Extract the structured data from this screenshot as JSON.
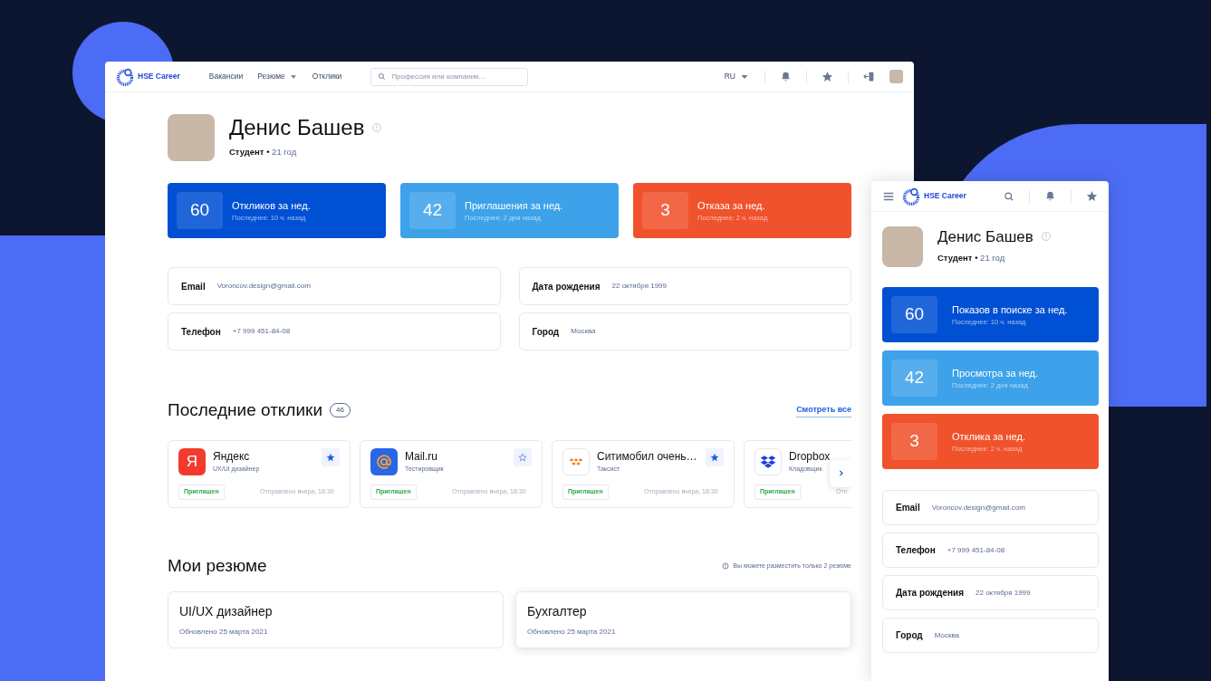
{
  "desktop": {
    "nav": {
      "logo": "HSE Career",
      "links": [
        {
          "label": "Вакансии",
          "dropdown": false
        },
        {
          "label": "Резюме",
          "dropdown": true
        },
        {
          "label": "Отклики",
          "dropdown": false
        }
      ],
      "search": {
        "placeholder": "Профессия или компания..."
      },
      "language": "RU"
    },
    "profile": {
      "name": "Денис Башев",
      "role": "Студент",
      "separator": "•",
      "age": "21 год"
    },
    "stats": [
      {
        "value": "60",
        "title": "Откликов за нед.",
        "subtitle": "Последнее: 10 ч. назад",
        "color": "#0050d4"
      },
      {
        "value": "42",
        "title": "Приглашения за нед.",
        "subtitle": "Последнее: 2 дня назад",
        "color": "#3da2ea"
      },
      {
        "value": "3",
        "title": "Отказа за нед.",
        "subtitle": "Последнее: 2 ч. назад",
        "color": "#f0522c"
      }
    ],
    "contacts": [
      {
        "label": "Email",
        "value": "Voroncov.design@gmail.com"
      },
      {
        "label": "Дата рождения",
        "value": "22 октября 1999"
      },
      {
        "label": "Телефон",
        "value": "+7 999 451-84-08"
      },
      {
        "label": "Город",
        "value": "Москва"
      }
    ],
    "responses": {
      "title": "Последние отклики",
      "count": "46",
      "view_all": "Смотреть все",
      "items": [
        {
          "kind": "yandex",
          "logo_text": "Я",
          "company": "Яндекс",
          "position": "UX/UI дизайнер",
          "starred": true,
          "status": "Приглашен",
          "sent": "Отправлено вчера, 18:30"
        },
        {
          "kind": "mail",
          "company": "Mail.ru",
          "position": "Тестировщик",
          "starred": false,
          "status": "Приглашен",
          "sent": "Отправлено вчера, 18:30"
        },
        {
          "kind": "citymobil",
          "company": "Ситимобил очень…",
          "position": "Таксист",
          "starred": true,
          "status": "Приглашен",
          "sent": "Отправлено вчера, 18:30"
        },
        {
          "kind": "dropbox",
          "company": "Dropbox",
          "position": "Кладовщик",
          "status": "Приглашен",
          "sent": "Отп"
        }
      ]
    },
    "resumes": {
      "title": "Мои резюме",
      "note": "Вы можете разместить только 2 резюме",
      "items": [
        {
          "title": "UI/UX дизайнер",
          "updated": "Обновлено 25 марта 2021",
          "selected": false
        },
        {
          "title": "Бухгалтер",
          "updated": "Обновлено 25 марта 2021",
          "selected": true
        }
      ]
    }
  },
  "mobile": {
    "nav": {
      "logo": "HSE Career"
    },
    "profile": {
      "name": "Денис Башев",
      "role": "Студент",
      "separator": "•",
      "age": "21 год"
    },
    "stats": [
      {
        "value": "60",
        "title": "Показов в поиске за нед.",
        "subtitle": "Последнее: 10 ч. назад",
        "color": "#0050d4"
      },
      {
        "value": "42",
        "title": "Просмотра за нед.",
        "subtitle": "Последнее: 2 дня назад",
        "color": "#3da2ea"
      },
      {
        "value": "3",
        "title": "Отклика за нед.",
        "subtitle": "Последнее: 2 ч. назад",
        "color": "#f0522c"
      }
    ],
    "contacts": [
      {
        "label": "Email",
        "value": "Voroncov.design@gmail.com"
      },
      {
        "label": "Телефон",
        "value": "+7 999 451-84-08"
      },
      {
        "label": "Дата рождения",
        "value": "22 октября 1999"
      },
      {
        "label": "Город",
        "value": "Москва"
      }
    ]
  }
}
